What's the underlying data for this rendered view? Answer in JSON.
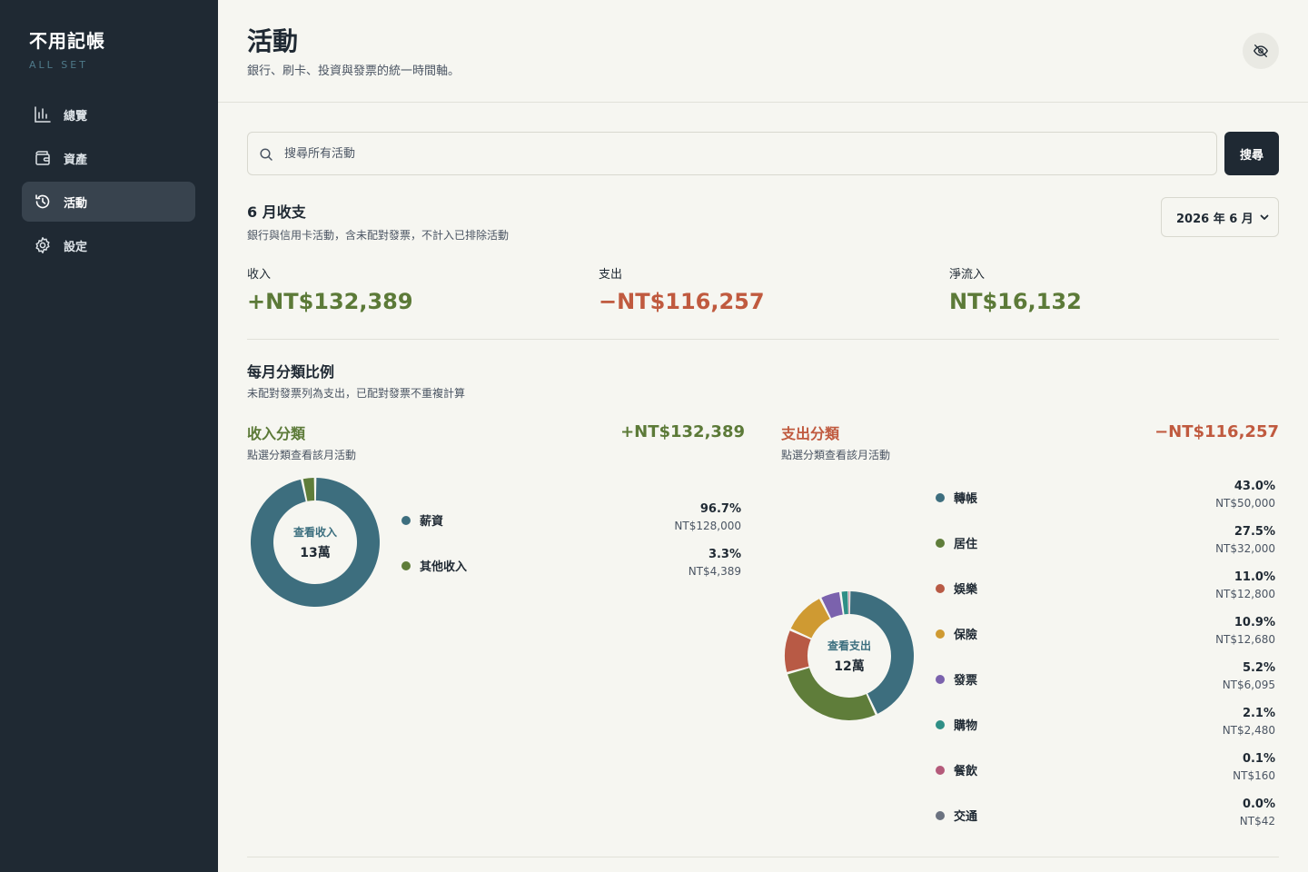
{
  "app": {
    "title": "不用記帳",
    "subtitle": "ALL SET"
  },
  "sidebar": {
    "items": [
      {
        "label": "總覽",
        "icon": "bar-chart-icon",
        "active": false
      },
      {
        "label": "資產",
        "icon": "wallet-icon",
        "active": false
      },
      {
        "label": "活動",
        "icon": "history-icon",
        "active": true
      },
      {
        "label": "設定",
        "icon": "gear-icon",
        "active": false
      }
    ]
  },
  "header": {
    "title": "活動",
    "subtitle": "銀行、刷卡、投資與發票的統一時間軸。",
    "privacy_icon": "eye-off-icon"
  },
  "search": {
    "placeholder": "搜尋所有活動",
    "value": "",
    "button_label": "搜尋"
  },
  "summary": {
    "title": "6 月收支",
    "subtitle": "銀行與信用卡活動，含未配對發票，不計入已排除活動",
    "month_selected": "2026 年 6 月",
    "income_label": "收入",
    "income_value": "+NT$132,389",
    "expense_label": "支出",
    "expense_value": "−NT$116,257",
    "net_label": "淨流入",
    "net_value": "NT$16,132"
  },
  "breakdown": {
    "title": "每月分類比例",
    "subtitle": "未配對發票列為支出，已配對發票不重複計算",
    "income": {
      "title": "收入分類",
      "total": "+NT$132,389",
      "hint": "點選分類查看該月活動",
      "center_action": "查看收入",
      "center_value": "13萬",
      "categories": [
        {
          "name": "薪資",
          "pct": "96.7%",
          "amount": "NT$128,000",
          "value": 96.7,
          "color": "#3d6e7e"
        },
        {
          "name": "其他收入",
          "pct": "3.3%",
          "amount": "NT$4,389",
          "value": 3.3,
          "color": "#5f7d3a"
        }
      ]
    },
    "expense": {
      "title": "支出分類",
      "total": "−NT$116,257",
      "hint": "點選分類查看該月活動",
      "center_action": "查看支出",
      "center_value": "12萬",
      "categories": [
        {
          "name": "轉帳",
          "pct": "43.0%",
          "amount": "NT$50,000",
          "value": 43.0,
          "color": "#3d6e7e"
        },
        {
          "name": "居住",
          "pct": "27.5%",
          "amount": "NT$32,000",
          "value": 27.5,
          "color": "#5f7d3a"
        },
        {
          "name": "娛樂",
          "pct": "11.0%",
          "amount": "NT$12,800",
          "value": 11.0,
          "color": "#b85a45"
        },
        {
          "name": "保險",
          "pct": "10.9%",
          "amount": "NT$12,680",
          "value": 10.9,
          "color": "#cf9a32"
        },
        {
          "name": "發票",
          "pct": "5.2%",
          "amount": "NT$6,095",
          "value": 5.2,
          "color": "#7b62ad"
        },
        {
          "name": "購物",
          "pct": "2.1%",
          "amount": "NT$2,480",
          "value": 2.1,
          "color": "#2f8f86"
        },
        {
          "name": "餐飲",
          "pct": "0.1%",
          "amount": "NT$160",
          "value": 0.1,
          "color": "#b45a7a"
        },
        {
          "name": "交通",
          "pct": "0.0%",
          "amount": "NT$42",
          "value": 0.0,
          "color": "#6b7280"
        }
      ]
    }
  }
}
